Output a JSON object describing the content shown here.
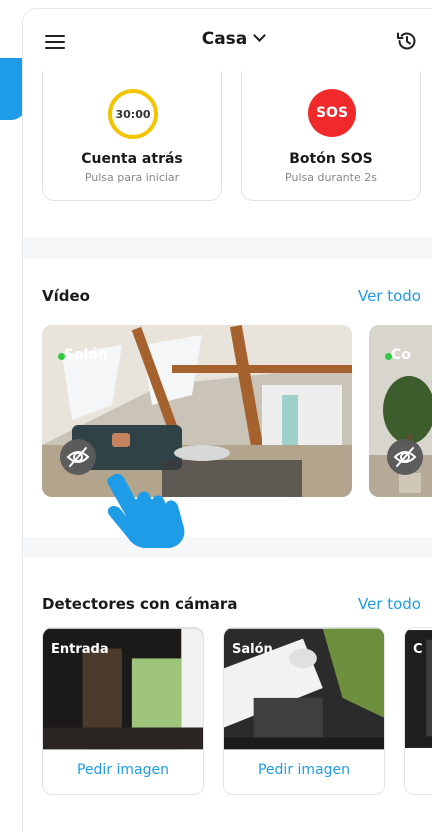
{
  "header": {
    "title": "Casa",
    "menu_icon": "menu-icon",
    "history_icon": "history-icon"
  },
  "quick_actions": [
    {
      "indicator": "30:00",
      "title": "Cuenta atrás",
      "subtitle": "Pulsa para iniciar",
      "color": "#f2c500"
    },
    {
      "indicator": "SOS",
      "title": "Botón SOS",
      "subtitle": "Pulsa durante 2s",
      "color": "#f02a2a"
    }
  ],
  "video": {
    "title": "Vídeo",
    "see_all": "Ver todo",
    "cameras": [
      {
        "name": "Salón",
        "status": "online"
      },
      {
        "name": "Co",
        "status": "online"
      }
    ]
  },
  "detectors": {
    "title": "Detectores con cámara",
    "see_all": "Ver todo",
    "items": [
      {
        "name": "Entrada",
        "action": "Pedir imagen"
      },
      {
        "name": "Salón",
        "action": "Pedir imagen"
      },
      {
        "name": "C",
        "action": ""
      }
    ]
  },
  "colors": {
    "accent": "#1e9ce8",
    "online": "#2ecc40",
    "sos": "#f02a2a",
    "timer": "#f2c500"
  }
}
